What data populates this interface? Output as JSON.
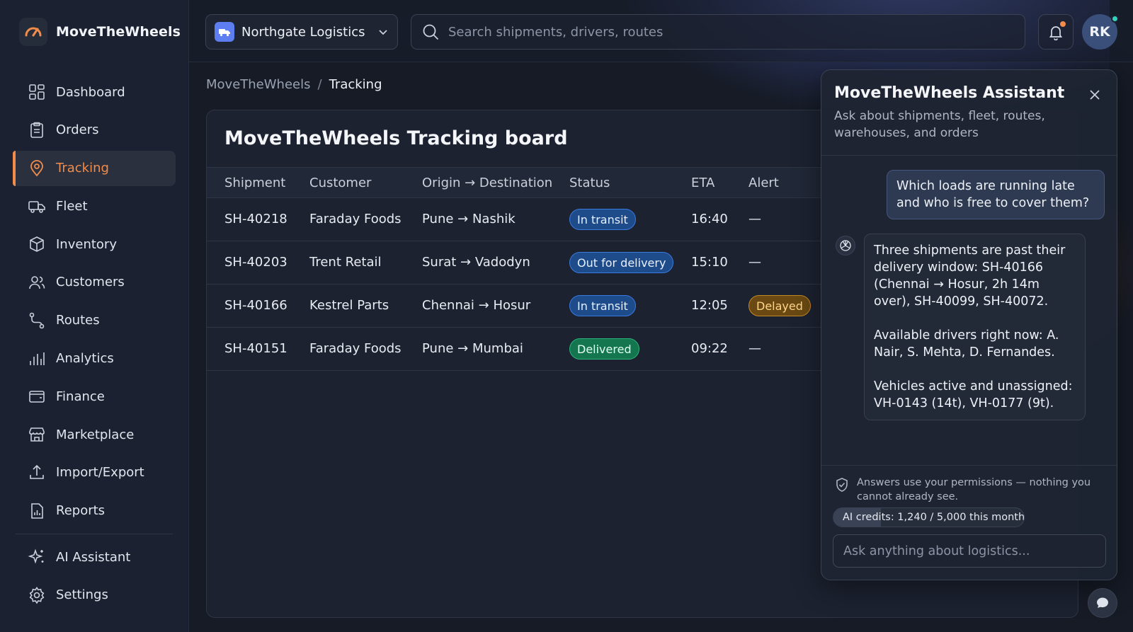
{
  "app": {
    "name": "MoveTheWheels"
  },
  "sidebar": {
    "items": [
      {
        "label": "Dashboard",
        "icon": "dashboard-icon"
      },
      {
        "label": "Orders",
        "icon": "clipboard-icon"
      },
      {
        "label": "Tracking",
        "icon": "location-pin-icon",
        "active": true
      },
      {
        "label": "Fleet",
        "icon": "truck-icon"
      },
      {
        "label": "Inventory",
        "icon": "box-icon"
      },
      {
        "label": "Customers",
        "icon": "users-icon"
      },
      {
        "label": "Routes",
        "icon": "route-icon"
      },
      {
        "label": "Analytics",
        "icon": "bar-chart-icon"
      },
      {
        "label": "Finance",
        "icon": "wallet-icon"
      },
      {
        "label": "Marketplace",
        "icon": "store-icon"
      },
      {
        "label": "Import/Export",
        "icon": "upload-icon"
      },
      {
        "label": "Reports",
        "icon": "report-icon"
      }
    ],
    "bottom_items": [
      {
        "label": "AI Assistant",
        "icon": "sparkle-icon"
      },
      {
        "label": "Settings",
        "icon": "gear-icon"
      }
    ]
  },
  "topbar": {
    "org_name": "Northgate Logistics",
    "search_placeholder": "Search shipments, drivers, routes",
    "avatar_initials": "RK"
  },
  "breadcrumb": {
    "root": "MoveTheWheels",
    "separator": "/",
    "current": "Tracking"
  },
  "board": {
    "title": "MoveTheWheels Tracking board",
    "columns": [
      "Shipment",
      "Customer",
      "Origin → Destination",
      "Status",
      "ETA",
      "Alert"
    ],
    "rows": [
      {
        "shipment": "SH-40218",
        "customer": "Faraday Foods",
        "origin": "Pune",
        "destination": "Nashik",
        "status": "In transit",
        "status_color": "blue",
        "eta": "16:40",
        "alert": "—"
      },
      {
        "shipment": "SH-40203",
        "customer": "Trent Retail",
        "origin": "Surat",
        "destination": "Vadodyn",
        "status": "Out for delivery",
        "status_color": "blue",
        "eta": "15:10",
        "alert": "—"
      },
      {
        "shipment": "SH-40166",
        "customer": "Kestrel Parts",
        "origin": "Chennai",
        "destination": "Hosur",
        "status": "In transit",
        "status_color": "blue",
        "eta": "12:05",
        "alert": "Delayed",
        "alert_color": "orange"
      },
      {
        "shipment": "SH-40151",
        "customer": "Faraday Foods",
        "origin": "Pune",
        "destination": "Mumbai",
        "status": "Delivered",
        "status_color": "green",
        "eta": "09:22",
        "alert": "—"
      }
    ]
  },
  "assistant": {
    "title": "MoveTheWheels Assistant",
    "subtitle": "Ask about shipments, fleet, routes, warehouses, and orders",
    "user_message": "Which loads are running late and who is free to cover them?",
    "ai_message": [
      "Three shipments are past their delivery window: SH-40166 (Chennai → Hosur, 2h 14m over), SH-40099, SH-40072.",
      "Available drivers right now: A. Nair, S. Mehta, D. Fernandes.",
      "Vehicles active and unassigned: VH-0143 (14t), VH-0177 (9t)."
    ],
    "permission_note": "Answers use your permissions — nothing you cannot already see.",
    "credits_text": "AI credits: 1,240 / 5,000 this month",
    "credits_used_fraction": 0.248,
    "input_placeholder": "Ask anything about logistics..."
  },
  "colors": {
    "accent": "#f28c4b",
    "badge_blue": "#1e4b8a",
    "badge_green": "#13764f",
    "badge_orange": "#6a4a12",
    "online": "#35d0b9"
  }
}
